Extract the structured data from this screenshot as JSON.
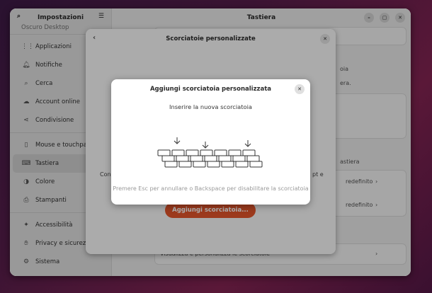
{
  "sidebar": {
    "title": "Impostazioni",
    "cut_item": "Oscuro Desktop",
    "items": [
      {
        "label": "Applicazioni",
        "icon": "grid-icon"
      },
      {
        "label": "Notifiche",
        "icon": "bell-icon"
      },
      {
        "label": "Cerca",
        "icon": "search-icon"
      },
      {
        "label": "Account online",
        "icon": "cloud-icon"
      },
      {
        "label": "Condivisione",
        "icon": "share-icon"
      },
      {
        "label": "Mouse e touchpad",
        "icon": "mouse-icon"
      },
      {
        "label": "Tastiera",
        "icon": "keyboard-icon"
      },
      {
        "label": "Colore",
        "icon": "color-icon"
      },
      {
        "label": "Stampanti",
        "icon": "printer-icon"
      },
      {
        "label": "Accessibilità",
        "icon": "accessibility-icon"
      },
      {
        "label": "Privacy e sicurezza",
        "icon": "hand-icon"
      },
      {
        "label": "Sistema",
        "icon": "gear-icon"
      }
    ]
  },
  "content": {
    "title": "Tastiera",
    "bg_snippets": {
      "a": "oia",
      "b": "era.",
      "c": "astiera",
      "d": "redefinito",
      "e": "redefinito",
      "f": "Visualizza e personalizza le scorciatoie"
    }
  },
  "dialog1": {
    "title": "Scorciatoie personalizzate",
    "left_text": "Con",
    "right_text": "pt e",
    "add_button": "Aggiungi scorciatoia..."
  },
  "dialog2": {
    "title": "Aggiungi scorciatoia personalizzata",
    "message": "Inserire la nuova scorciatoia",
    "hint": "Premere Esc per annullare o Backspace per disabilitare la scorciatoia"
  },
  "colors": {
    "accent": "#e0542a"
  }
}
